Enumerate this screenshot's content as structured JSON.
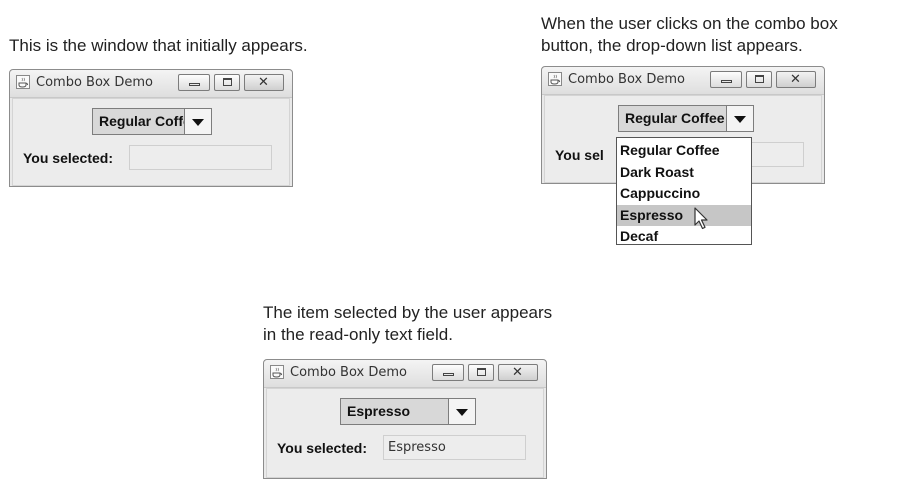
{
  "captions": {
    "initial": "This is the window that initially appears.",
    "dropdown_line1": "When the user clicks on the combo box",
    "dropdown_line2": "button, the drop-down list appears.",
    "selected_line1": "The item selected by the user appears",
    "selected_line2": "in the read-only text field."
  },
  "windows": [
    {
      "title": "Combo Box Demo",
      "combo_value": "Regular Coffee",
      "label": "You selected:",
      "field_value": ""
    },
    {
      "title": "Combo Box Demo",
      "combo_value": "Regular Coffee",
      "label": "You sel",
      "field_value": ""
    },
    {
      "title": "Combo Box Demo",
      "combo_value": "Espresso",
      "label": "You selected:",
      "field_value": "Espresso"
    }
  ],
  "dropdown": {
    "items": [
      "Regular Coffee",
      "Dark Roast",
      "Cappuccino",
      "Espresso",
      "Decaf"
    ],
    "highlighted": "Espresso"
  },
  "icons": {
    "window_app": "java-cup-icon",
    "minimize": "minimize-icon",
    "maximize": "maximize-icon",
    "close": "close-icon",
    "combo_arrow": "chevron-down-icon",
    "cursor": "mouse-pointer-icon"
  },
  "colors": {
    "window_bg": "#e9e9e9",
    "combo_bg": "#d8d8d8",
    "highlight": "#c6c6c6"
  }
}
